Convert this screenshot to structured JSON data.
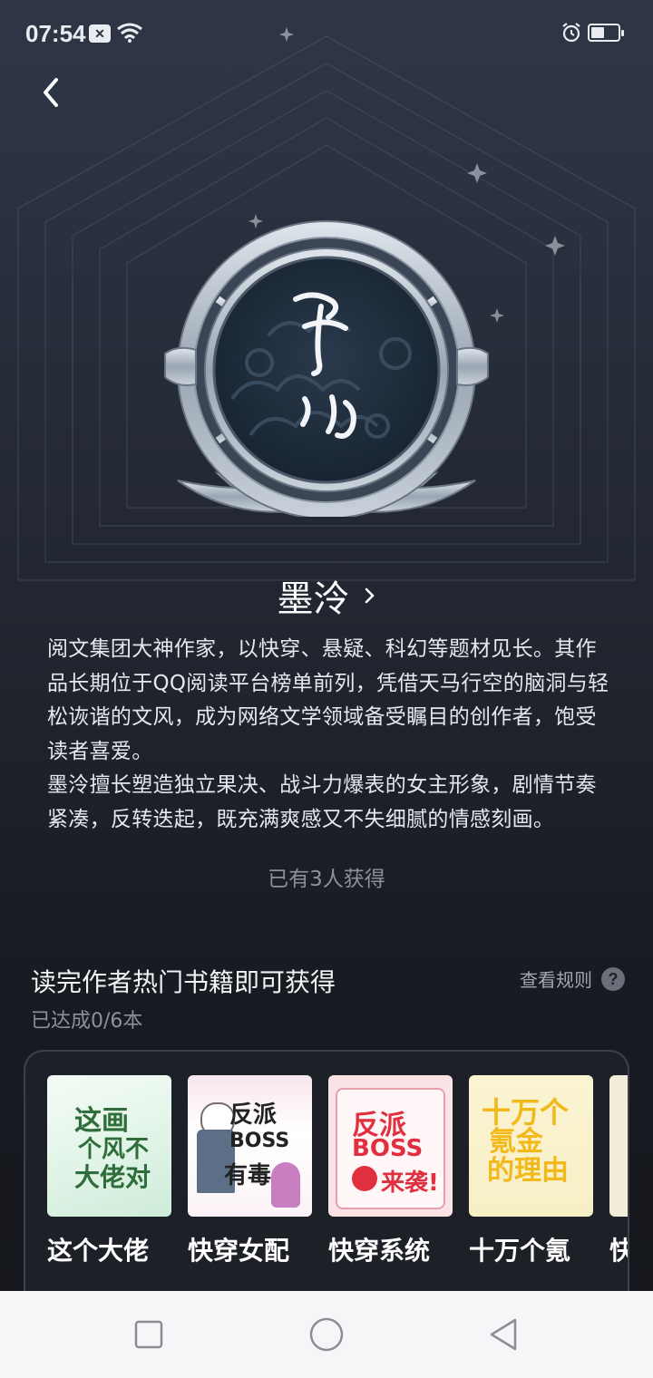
{
  "status_bar": {
    "time": "07:54",
    "notification_badge": "✕"
  },
  "badge": {
    "calligraphy": "墨泠"
  },
  "author": {
    "name": "墨泠",
    "description": [
      "阅文集团大神作家，以快穿、悬疑、科幻等题材见长。其作品长期位于QQ阅读平台榜单前列，凭借天马行空的脑洞与轻松诙谐的文风，成为网络文学领域备受瞩目的创作者，饱受读者喜爱。",
      "墨泠擅长塑造独立果决、战斗力爆表的女主形象，剧情节奏紧凑，反转迭起，既充满爽感又不失细腻的情感刻画。"
    ],
    "obtained_count": "已有3人获得"
  },
  "task": {
    "title": "读完作者热门书籍即可获得",
    "rules_label": "查看规则",
    "progress": "已达成0/6本"
  },
  "books": [
    {
      "title": "这个大佬",
      "cover_text": "这个大佬画风不对"
    },
    {
      "title": "快穿女配",
      "cover_text": "反派BOSS有毒"
    },
    {
      "title": "快穿系统",
      "cover_text": "反派BOSS来袭!"
    },
    {
      "title": "十万个氪",
      "cover_text": "十万个氪金的理由"
    },
    {
      "title": "快",
      "cover_text": ""
    }
  ],
  "colors": {
    "background_top": "#2f3747",
    "background_bottom": "#15171c",
    "accent_silver": "#b9c3cf"
  },
  "icons": [
    "back-icon",
    "chevron-right-icon",
    "help-icon",
    "wifi-icon",
    "alarm-icon",
    "battery-icon",
    "nav-recent-icon",
    "nav-home-icon",
    "nav-back-icon"
  ]
}
